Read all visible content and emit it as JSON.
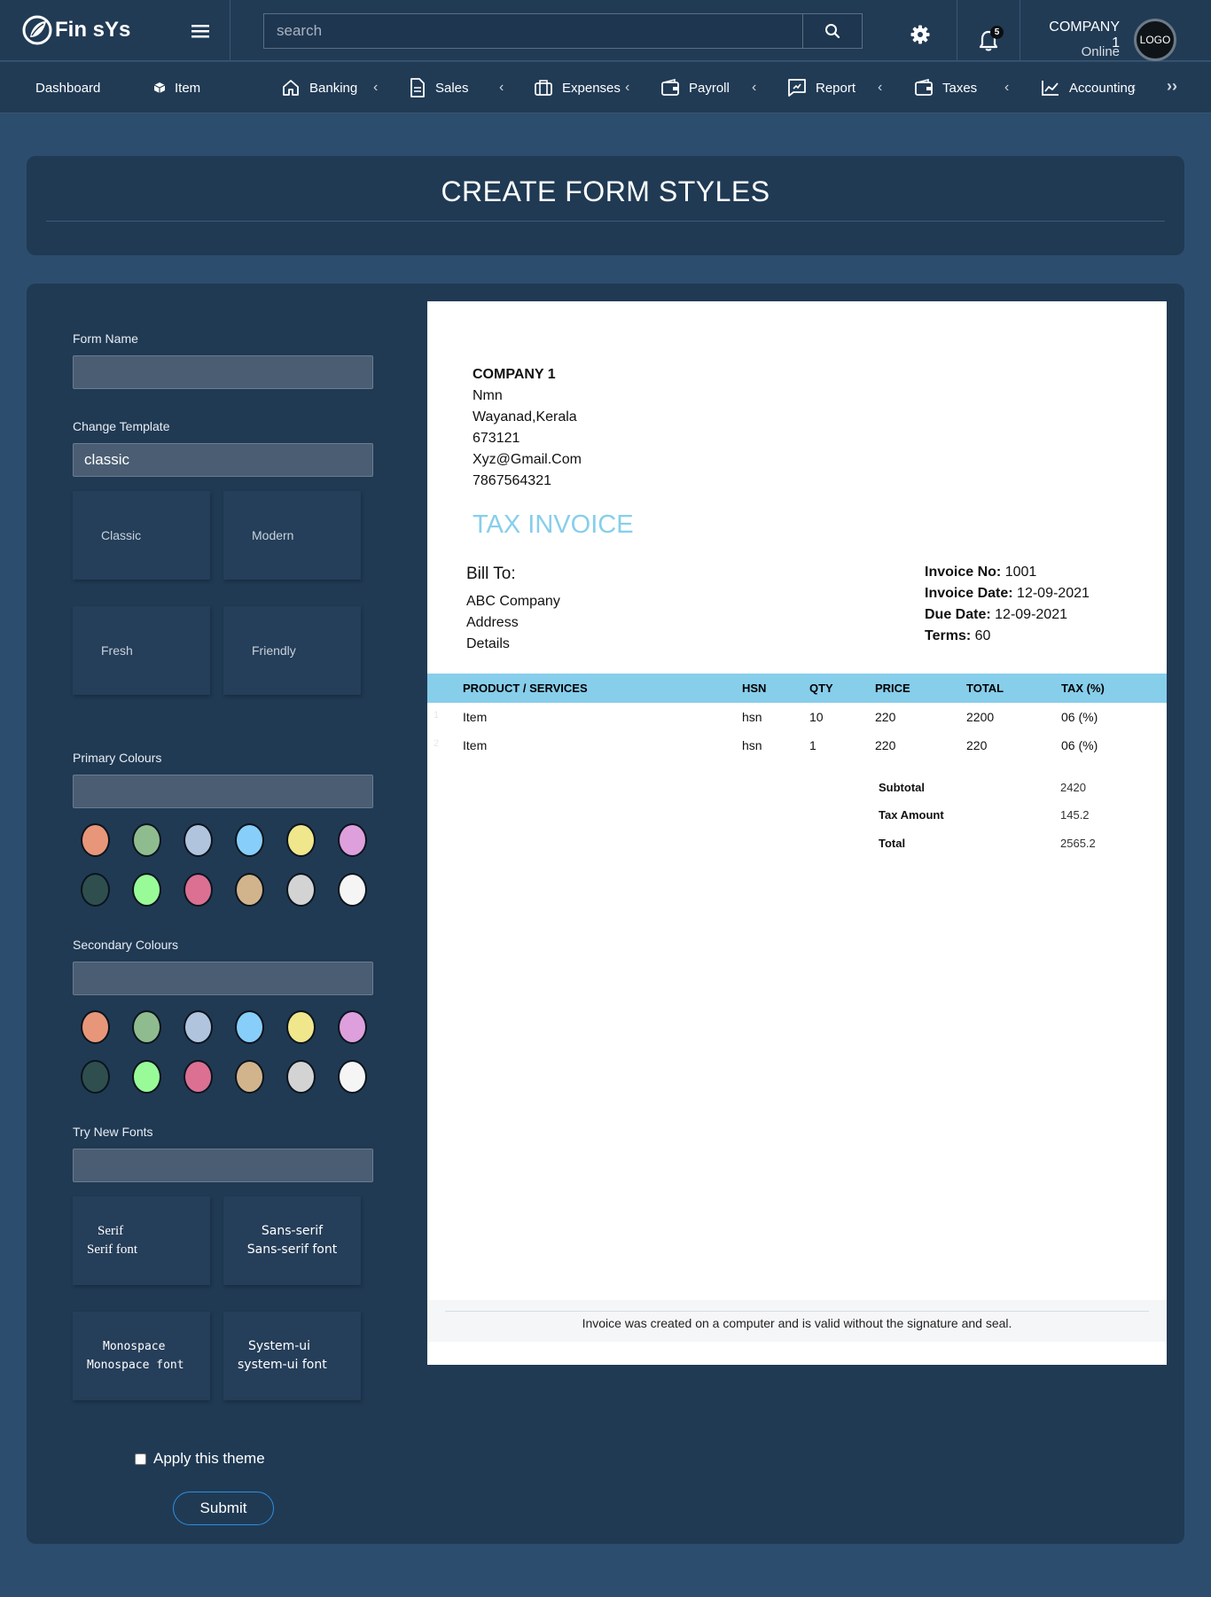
{
  "app": {
    "brand": "Fin sYs"
  },
  "search": {
    "placeholder": "search"
  },
  "header": {
    "notifications": "5",
    "company": "COMPANY 1",
    "status": "Online",
    "avatar_text": "LOGO"
  },
  "nav": {
    "items": [
      {
        "label": "Dashboard"
      },
      {
        "label": "Item"
      },
      {
        "label": "Banking"
      },
      {
        "label": "Sales"
      },
      {
        "label": "Expenses"
      },
      {
        "label": "Payroll"
      },
      {
        "label": "Report"
      },
      {
        "label": "Taxes"
      },
      {
        "label": "Accounting"
      }
    ],
    "chevron": "‹",
    "more": "››"
  },
  "page": {
    "title": "CREATE FORM STYLES"
  },
  "form": {
    "form_name_label": "Form Name",
    "form_name_value": "",
    "template_label": "Change Template",
    "template_value": "classic",
    "templates": [
      "Classic",
      "Modern",
      "Fresh",
      "Friendly"
    ],
    "primary_label": "Primary Colours",
    "secondary_label": "Secondary Colours",
    "colours": [
      "#e8967a",
      "#8fbc8f",
      "#b0c4de",
      "#87cefa",
      "#f0e68c",
      "#dda0dd",
      "#2f4f4f",
      "#98fb98",
      "#db7093",
      "#d2b48c",
      "#d3d3d3",
      "#f5f5f5"
    ],
    "fonts_label": "Try New Fonts",
    "fonts": [
      {
        "name": "Serif",
        "sample": "Serif font"
      },
      {
        "name": "Sans-serif",
        "sample": "Sans-serif font"
      },
      {
        "name": "Monospace",
        "sample": "Monospace font"
      },
      {
        "name": "System-ui",
        "sample": "system-ui font"
      }
    ],
    "apply_label": "Apply this theme",
    "submit_label": "Submit"
  },
  "invoice": {
    "company": {
      "name": "COMPANY 1",
      "line1": "Nmn",
      "line2": "Wayanad,Kerala",
      "pin": "673121",
      "email": "Xyz@Gmail.Com",
      "phone": "7867564321"
    },
    "title": "TAX INVOICE",
    "bill_to_label": "Bill To:",
    "bill_to": [
      "ABC Company",
      "Address",
      "Details"
    ],
    "meta": {
      "no_label": "Invoice No:",
      "no": "1001",
      "date_label": "Invoice Date:",
      "date": "12-09-2021",
      "due_label": "Due Date:",
      "due": "12-09-2021",
      "terms_label": "Terms:",
      "terms": "60"
    },
    "columns": [
      "PRODUCT / SERVICES",
      "HSN",
      "QTY",
      "PRICE",
      "TOTAL",
      "TAX (%)"
    ],
    "rows": [
      {
        "num": "1",
        "product": "Item",
        "hsn": "hsn",
        "qty": "10",
        "price": "220",
        "total": "2200",
        "tax": "06 (%)"
      },
      {
        "num": "2",
        "product": "Item",
        "hsn": "hsn",
        "qty": "1",
        "price": "220",
        "total": "220",
        "tax": "06 (%)"
      }
    ],
    "summary": {
      "subtotal_label": "Subtotal",
      "subtotal": "2420",
      "tax_label": "Tax Amount",
      "tax": "145.2",
      "total_label": "Total",
      "total": "2565.2"
    },
    "footer": "Invoice was created on a computer and is valid without the signature and seal."
  }
}
